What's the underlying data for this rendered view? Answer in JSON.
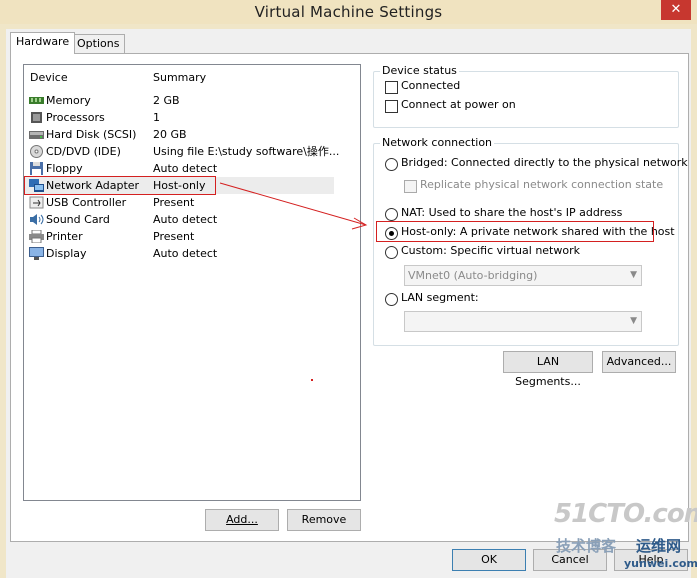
{
  "window": {
    "title": "Virtual Machine Settings",
    "close_glyph": "✕"
  },
  "tabs": [
    {
      "label": "Hardware"
    },
    {
      "label": "Options"
    }
  ],
  "device_list": {
    "header_device": "Device",
    "header_summary": "Summary",
    "rows": [
      {
        "name": "Memory",
        "summary": "2 GB",
        "icon": "memory-icon"
      },
      {
        "name": "Processors",
        "summary": "1",
        "icon": "processor-icon"
      },
      {
        "name": "Hard Disk (SCSI)",
        "summary": "20 GB",
        "icon": "hard-disk-icon"
      },
      {
        "name": "CD/DVD (IDE)",
        "summary": "Using file E:\\study software\\操作...",
        "icon": "cd-dvd-icon"
      },
      {
        "name": "Floppy",
        "summary": "Auto detect",
        "icon": "floppy-icon"
      },
      {
        "name": "Network Adapter",
        "summary": "Host-only",
        "icon": "network-adapter-icon"
      },
      {
        "name": "USB Controller",
        "summary": "Present",
        "icon": "usb-icon"
      },
      {
        "name": "Sound Card",
        "summary": "Auto detect",
        "icon": "sound-card-icon"
      },
      {
        "name": "Printer",
        "summary": "Present",
        "icon": "printer-icon"
      },
      {
        "name": "Display",
        "summary": "Auto detect",
        "icon": "display-icon"
      }
    ],
    "selected_index": 5
  },
  "buttons": {
    "add": "Add...",
    "remove": "Remove",
    "lan_segments": "LAN Segments...",
    "advanced": "Advanced...",
    "ok": "OK",
    "cancel": "Cancel",
    "help": "Help"
  },
  "device_status": {
    "legend": "Device status",
    "connected": "Connected",
    "connect_at_power_on": "Connect at power on",
    "connected_checked": false,
    "connect_at_power_on_checked": false
  },
  "network_connection": {
    "legend": "Network connection",
    "bridged": "Bridged: Connected directly to the physical network",
    "replicate": "Replicate physical network connection state",
    "nat": "NAT: Used to share the host's IP address",
    "host_only": "Host-only: A private network shared with the host",
    "custom": "Custom: Specific virtual network",
    "custom_value": "VMnet0 (Auto-bridging)",
    "lan_segment": "LAN segment:",
    "lan_segment_value": "",
    "selected": "host_only"
  },
  "watermark": {
    "main": "51CTO.com",
    "sub": "技术博客",
    "brand": "运维网",
    "url": "yunwei.com"
  },
  "colors": {
    "annotation_red": "#d42020",
    "title_bar": "#f0e3c0",
    "close_red": "#c7372f"
  }
}
